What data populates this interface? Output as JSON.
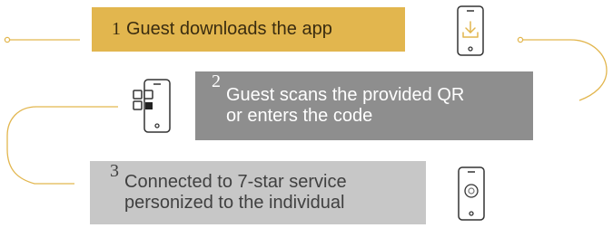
{
  "steps": [
    {
      "number": "1",
      "lines": [
        "Guest downloads the app"
      ],
      "icon": "phone-download-icon",
      "color": "#e2b64e"
    },
    {
      "number": "2",
      "lines": [
        "Guest scans the provided QR",
        "or enters the code"
      ],
      "icon": "phone-qr-code-icon",
      "color": "#8e8e8e"
    },
    {
      "number": "3",
      "lines": [
        "Connected to 7-star service",
        "personized to the individual"
      ],
      "icon": "phone-concierge-icon",
      "color": "#c7c7c7"
    }
  ],
  "connector_color": "#e2b64e"
}
